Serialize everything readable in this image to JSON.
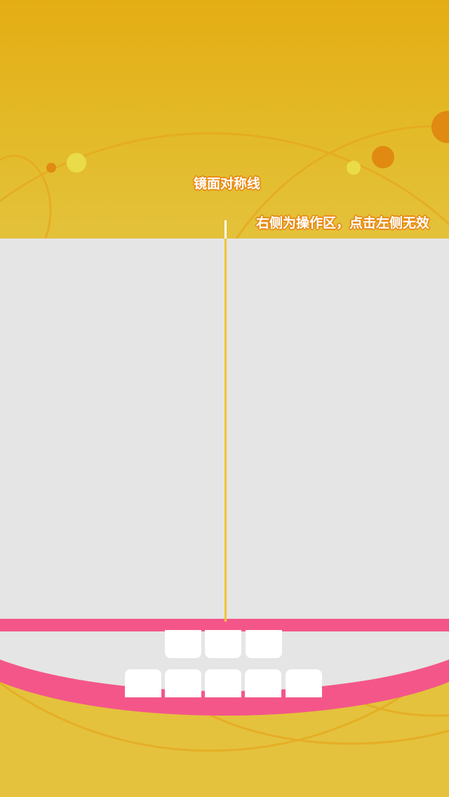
{
  "labels": {
    "mirror_line": "镜面对称线",
    "hint": "右侧为操作区，点击左侧无效"
  },
  "colors": {
    "background": "#e3bb2a",
    "play_area": "#e5e5e5",
    "mirror_line": "#f2c534",
    "lips": "#f4568a",
    "teeth": "#ffffff",
    "label_outline": "#e88a12"
  },
  "teeth": {
    "upper_count": 3,
    "lower_count": 5
  }
}
